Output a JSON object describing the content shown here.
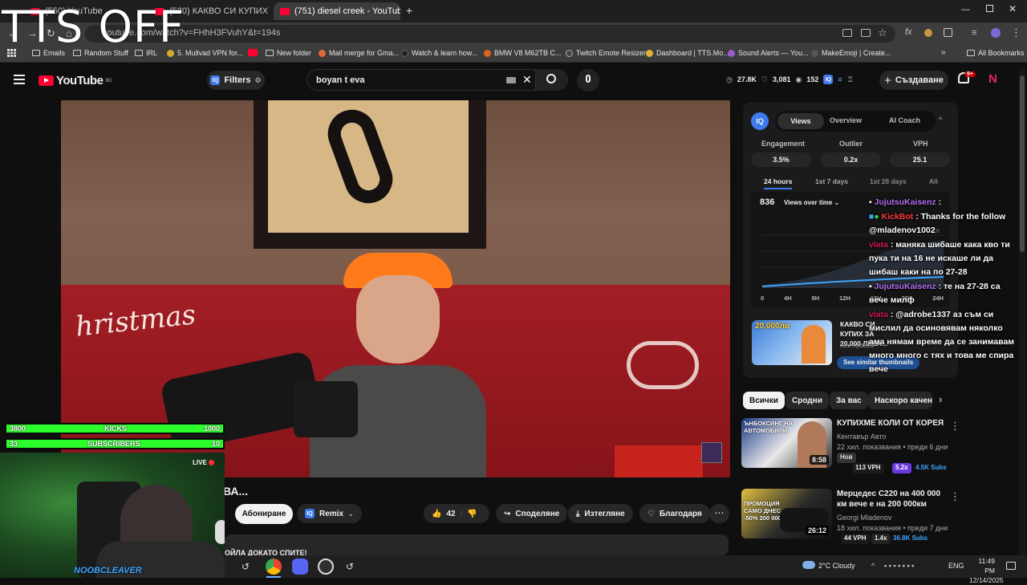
{
  "overlay": {
    "tts": "TTS OFF"
  },
  "browser": {
    "tabs": [
      {
        "label": "(550) YouTube"
      },
      {
        "label": "(530) КАКВО СИ КУПИХ ЗА ..."
      },
      {
        "label": "(751) diesel creek - YouTub"
      }
    ],
    "new_tab": "+",
    "url": "youtube.com/watch?v=FHhH3FVuhY&t=194s",
    "bookmarks": [
      "Emails",
      "Random Stuff",
      "IRL",
      "5. Mullvad VPN for...",
      "",
      "New folder",
      "Mail merge for Gma...",
      "Watch & learn how...",
      "BMW V8 M62TB C...",
      "Twitch Emote Resizer",
      "Dashboard | TTS.Mo...",
      "Sound Alerts — You...",
      "MakeEmoji | Create..."
    ],
    "all_bookmarks": "All Bookmarks"
  },
  "youtube": {
    "logo": "YouTube",
    "region": "BG",
    "filters": "Filters",
    "search_value": "boyan t eva",
    "header_stats": {
      "views": "27.8K",
      "likes": "3,081",
      "viewers": "152"
    },
    "create": "Създаване",
    "notif_count": "9+",
    "avatar_letter": "N"
  },
  "video": {
    "frame_text": "hristmas",
    "title_fragment": "ВА...",
    "subscribe": "Абониране",
    "remix": "Remix",
    "likes": "42",
    "share": "Споделяне",
    "download": "Изтегляне",
    "thanks": "Благодаря",
    "comment_teaser": "ОЙЛА ДОКАТО СПИТЕ!"
  },
  "iq_panel": {
    "iq": "IQ",
    "tabs": [
      "Views",
      "Overview",
      "AI Coach"
    ],
    "metrics": [
      {
        "label": "Engagement",
        "value": "3.5%"
      },
      {
        "label": "Outlier",
        "value": "0.2x"
      },
      {
        "label": "VPH",
        "value": "25.1"
      }
    ],
    "ranges": [
      "24 hours",
      "1st 7 days",
      "1st 28 days",
      "All"
    ],
    "views_total": "836",
    "views_dropdown": "Views over time",
    "y_ticks": [
      "1K"
    ],
    "x_ticks": [
      "0",
      "4H",
      "8H",
      "12H",
      "16H",
      "20H",
      "24H"
    ],
    "suggestion_title": "КАКВО СИ КУПИХ ЗА 20,000 ЛЕВА...",
    "suggestion_meta": "Last Updated",
    "suggestion_thumb_text": "20,000лв",
    "similar_btn": "See similar thumbnails"
  },
  "chat": [
    {
      "user": "JujutsuKaisenz",
      "text": ":",
      "color": "purple"
    },
    {
      "user": "KickBot",
      "text": ": Thanks for the follow @mladenov1002",
      "color": "red"
    },
    {
      "user": "vlata",
      "text": ": маняка шибаше кака кво ти пука ти на 16 не искаше ли да шибаш каки на по 27-28",
      "color": "pink"
    },
    {
      "user": "JujutsuKaisenz",
      "text": ": те на 27-28 са вече милф",
      "color": "purple"
    },
    {
      "user": "vlata",
      "text": ": @adrobe1337 аз съм си мислил да осиновявам няколко ама нямам време да се занимавам много много с тях и това ме спира вече",
      "color": "pink"
    }
  ],
  "chips": [
    "Всички",
    "Сродни",
    "За вас",
    "Наскоро качени"
  ],
  "recommendations": [
    {
      "title": "КУПИХМЕ КОЛИ ОТ КОРЕЯ",
      "channel": "Кентавър Авто",
      "meta": "22 хил. показвания • преди 6 дни",
      "badge": "Нов",
      "vph": "113 VPH",
      "outlier": "5.2x",
      "subs": "4.5K Subs",
      "duration": "8:58",
      "thumb_text": "ЪНБОКСИНГ НА АВТОМОБИЛИ"
    },
    {
      "title": "Мерцедес С220 на 400 000 км вече е на 200 000км",
      "channel": "Georgi Mladenov",
      "meta": "18 хил. показвания • преди 7 дни",
      "vph": "44 VPH",
      "outlier": "1.4x",
      "subs": "36.8K Subs",
      "duration": "26:12",
      "thumb_text": "ПРОМОЦИЯ САМО ДНЕС -50% 200 000 км"
    }
  ],
  "stream": {
    "goal1_left": "3800",
    "goal1_label": "KICKS",
    "goal1_right": "1000",
    "goal1_progress": 1.0,
    "goal2_left": "33",
    "goal2_label": "SUBSCRIBERS",
    "goal2_right": "10",
    "goal2_progress": 1.0,
    "live": "LIVE",
    "name": "NOOBCLEAVER"
  },
  "taskbar": {
    "weather": "2°C  Cloudy",
    "lang": "ENG",
    "time": "11:49 PM",
    "date": "12/14/2025"
  },
  "colors": {
    "accent_red": "#ff0033",
    "iq_blue": "#3e7bf0",
    "goal_green": "#2bff2b",
    "chart_line": "#3ea6ff"
  }
}
